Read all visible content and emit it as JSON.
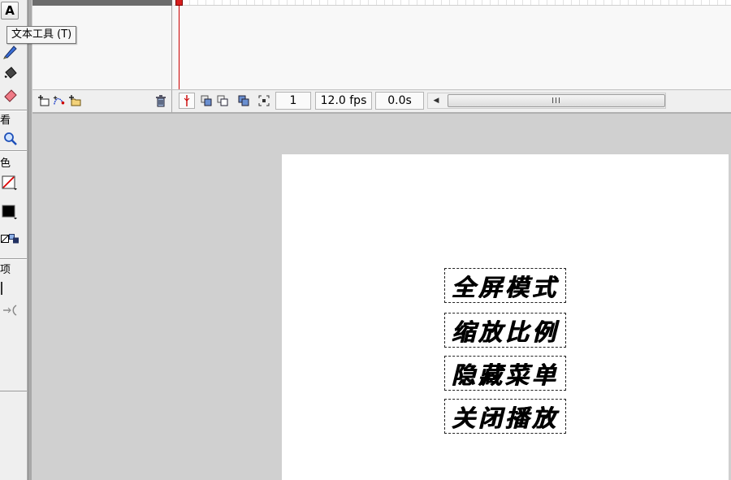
{
  "tools": {
    "text_tool_glyph": "A",
    "tooltip": "文本工具 (T)",
    "sections": {
      "view": "看",
      "color": "色",
      "options": "项"
    },
    "icons": [
      "pencil-icon",
      "ink-bottle-icon",
      "eraser-icon",
      "zoom-icon",
      "stroke-color-icon",
      "fill-color-icon",
      "swap-colors-icon",
      "snap-icon"
    ]
  },
  "timeline": {
    "frame_number": "1",
    "fps": "12.0 fps",
    "elapsed": "0.0s",
    "scroll_left_glyph": "◀",
    "scroll_thumb_grip": "III",
    "colors": {
      "playhead": "#cc0000"
    }
  },
  "stage": {
    "menu_items": [
      "全屏模式",
      "缩放比例",
      "隐藏菜单",
      "关闭播放"
    ]
  }
}
